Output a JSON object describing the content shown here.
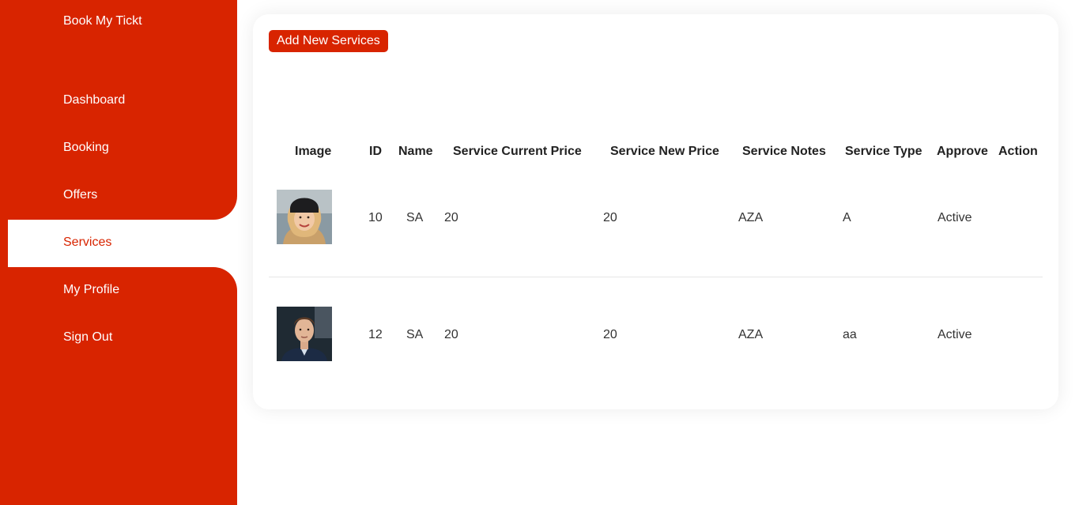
{
  "sidebar": {
    "brand": "Book My Tickt",
    "items": [
      {
        "label": "Dashboard"
      },
      {
        "label": "Booking"
      },
      {
        "label": "Offers"
      },
      {
        "label": "Services"
      },
      {
        "label": "My Profile"
      },
      {
        "label": "Sign Out"
      }
    ],
    "active": "Services",
    "accent_color": "#d82400"
  },
  "main": {
    "add_button_label": "Add New Services",
    "table": {
      "headers": [
        "Image",
        "ID",
        "Name",
        "Service Current Price",
        "Service New Price",
        "Service Notes",
        "Service Type",
        "Approve",
        "Action"
      ],
      "rows": [
        {
          "image": "woman-portrait",
          "id": "10",
          "name": "SA",
          "current_price": "20",
          "new_price": "20",
          "notes": "AZA",
          "type": "A",
          "approve": "Active"
        },
        {
          "image": "man-portrait",
          "id": "12",
          "name": "SA",
          "current_price": "20",
          "new_price": "20",
          "notes": "AZA",
          "type": "aa",
          "approve": "Active"
        }
      ]
    }
  }
}
